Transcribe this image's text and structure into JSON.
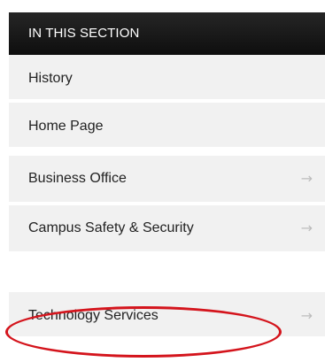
{
  "section_nav": {
    "header": "IN THIS SECTION",
    "items_group1": [
      {
        "label": "History",
        "has_arrow": false
      },
      {
        "label": "Home Page",
        "has_arrow": false
      }
    ],
    "items_group2": [
      {
        "label": "Business Office",
        "has_arrow": true,
        "arrow": "→"
      },
      {
        "label": "Campus Safety & Security",
        "has_arrow": true,
        "arrow": "→"
      }
    ],
    "items_group3": [
      {
        "label": "Technology Services",
        "has_arrow": true,
        "arrow": "→"
      }
    ]
  },
  "annotation": {
    "color": "#d4141c",
    "highlighted_item": "Technology Services"
  }
}
